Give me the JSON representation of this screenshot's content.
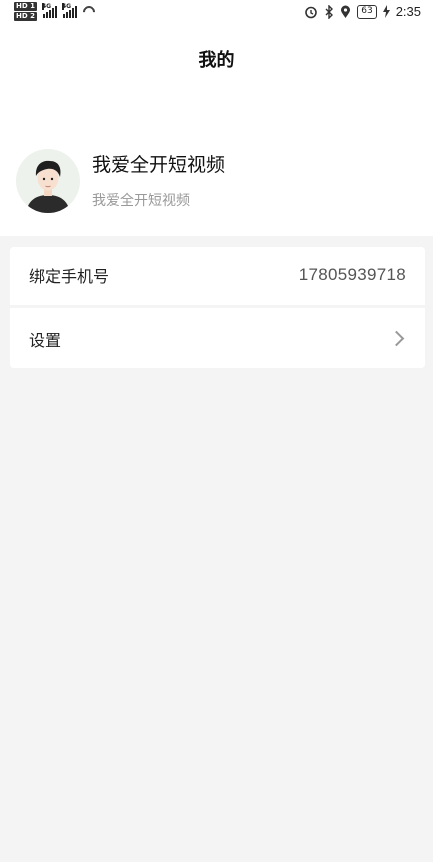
{
  "status_bar": {
    "sim1": "HD 1",
    "sim2": "HD 2",
    "net1": "4G",
    "net2": "4G",
    "battery": "63",
    "time": "2:35"
  },
  "header": {
    "title": "我的",
    "username": "我爱全开短视频",
    "subtitle": "我爱全开短视频"
  },
  "settings": {
    "phone_label": "绑定手机号",
    "phone_value": "17805939718",
    "settings_label": "设置"
  },
  "colors": {
    "background": "#f4f4f4",
    "card": "#ffffff",
    "subtitle": "#999999"
  }
}
